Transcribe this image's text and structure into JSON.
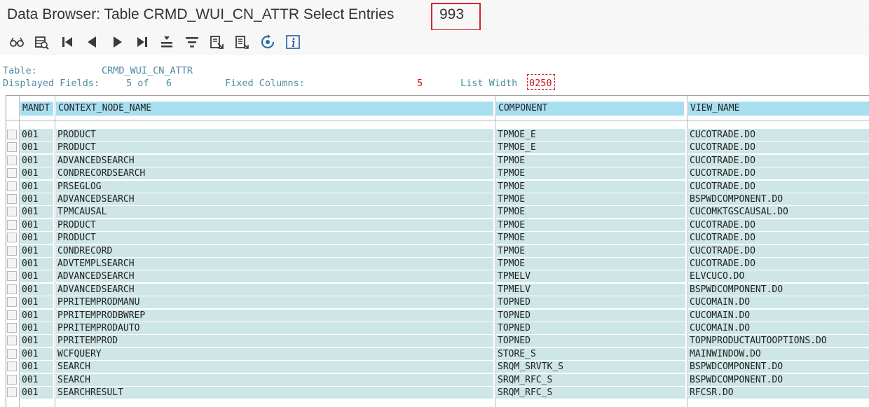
{
  "window": {
    "title": "Data Browser: Table CRMD_WUI_CN_ATTR Select Entries",
    "entry_count": "993"
  },
  "toolbar": {
    "icons": [
      "glasses-icon",
      "check-table-icon",
      "first-page-icon",
      "previous-page-icon",
      "next-page-icon",
      "last-page-icon",
      "sort-ascending-icon",
      "filter-icon",
      "export-icon",
      "print-icon",
      "refresh-icon",
      "info-icon"
    ]
  },
  "info": {
    "table_label": "Table:",
    "table_value": "CRMD_WUI_CN_ATTR",
    "displayed_fields_label": "Displayed Fields:",
    "displayed_fields_value": "5 of   6",
    "fixed_columns_label": "Fixed Columns:",
    "fixed_columns_value": "5",
    "list_width_label": "List Width",
    "list_width_value": "0250"
  },
  "table": {
    "columns": [
      "MANDT",
      "CONTEXT_NODE_NAME",
      "COMPONENT",
      "VIEW_NAME"
    ],
    "rows": [
      [
        "001",
        "PRODUCT",
        "TPMOE_E",
        "CUCOTRADE.DO"
      ],
      [
        "001",
        "PRODUCT",
        "TPMOE_E",
        "CUCOTRADE.DO"
      ],
      [
        "001",
        "ADVANCEDSEARCH",
        "TPMOE",
        "CUCOTRADE.DO"
      ],
      [
        "001",
        "CONDRECORDSEARCH",
        "TPMOE",
        "CUCOTRADE.DO"
      ],
      [
        "001",
        "PRSEGLOG",
        "TPMOE",
        "CUCOTRADE.DO"
      ],
      [
        "001",
        "ADVANCEDSEARCH",
        "TPMOE",
        "BSPWDCOMPONENT.DO"
      ],
      [
        "001",
        "TPMCAUSAL",
        "TPMOE",
        "CUCOMKTGSCAUSAL.DO"
      ],
      [
        "001",
        "PRODUCT",
        "TPMOE",
        "CUCOTRADE.DO"
      ],
      [
        "001",
        "PRODUCT",
        "TPMOE",
        "CUCOTRADE.DO"
      ],
      [
        "001",
        "CONDRECORD",
        "TPMOE",
        "CUCOTRADE.DO"
      ],
      [
        "001",
        "ADVTEMPLSEARCH",
        "TPMOE",
        "CUCOTRADE.DO"
      ],
      [
        "001",
        "ADVANCEDSEARCH",
        "TPMELV",
        "ELVCUCO.DO"
      ],
      [
        "001",
        "ADVANCEDSEARCH",
        "TPMELV",
        "BSPWDCOMPONENT.DO"
      ],
      [
        "001",
        "PPRITEMPRODMANU",
        "TOPNED",
        "CUCOMAIN.DO"
      ],
      [
        "001",
        "PPRITEMPRODBWREP",
        "TOPNED",
        "CUCOMAIN.DO"
      ],
      [
        "001",
        "PPRITEMPRODAUTO",
        "TOPNED",
        "CUCOMAIN.DO"
      ],
      [
        "001",
        "PPRITEMPROD",
        "TOPNED",
        "TOPNPRODUCTAUTOOPTIONS.DO"
      ],
      [
        "001",
        "WCFQUERY",
        "STORE_S",
        "MAINWINDOW.DO"
      ],
      [
        "001",
        "SEARCH",
        "SRQM_SRVTK_S",
        "BSPWDCOMPONENT.DO"
      ],
      [
        "001",
        "SEARCH",
        "SRQM_RFC_S",
        "BSPWDCOMPONENT.DO"
      ],
      [
        "001",
        "SEARCHRESULT",
        "SRQM_RFC_S",
        "RFCSR.DO"
      ]
    ]
  },
  "colors": {
    "header_bg": "#a8dff0",
    "cell_bg": "#cfe6e6",
    "info_text": "#4c8ba3",
    "highlight_red": "#d9232d"
  }
}
